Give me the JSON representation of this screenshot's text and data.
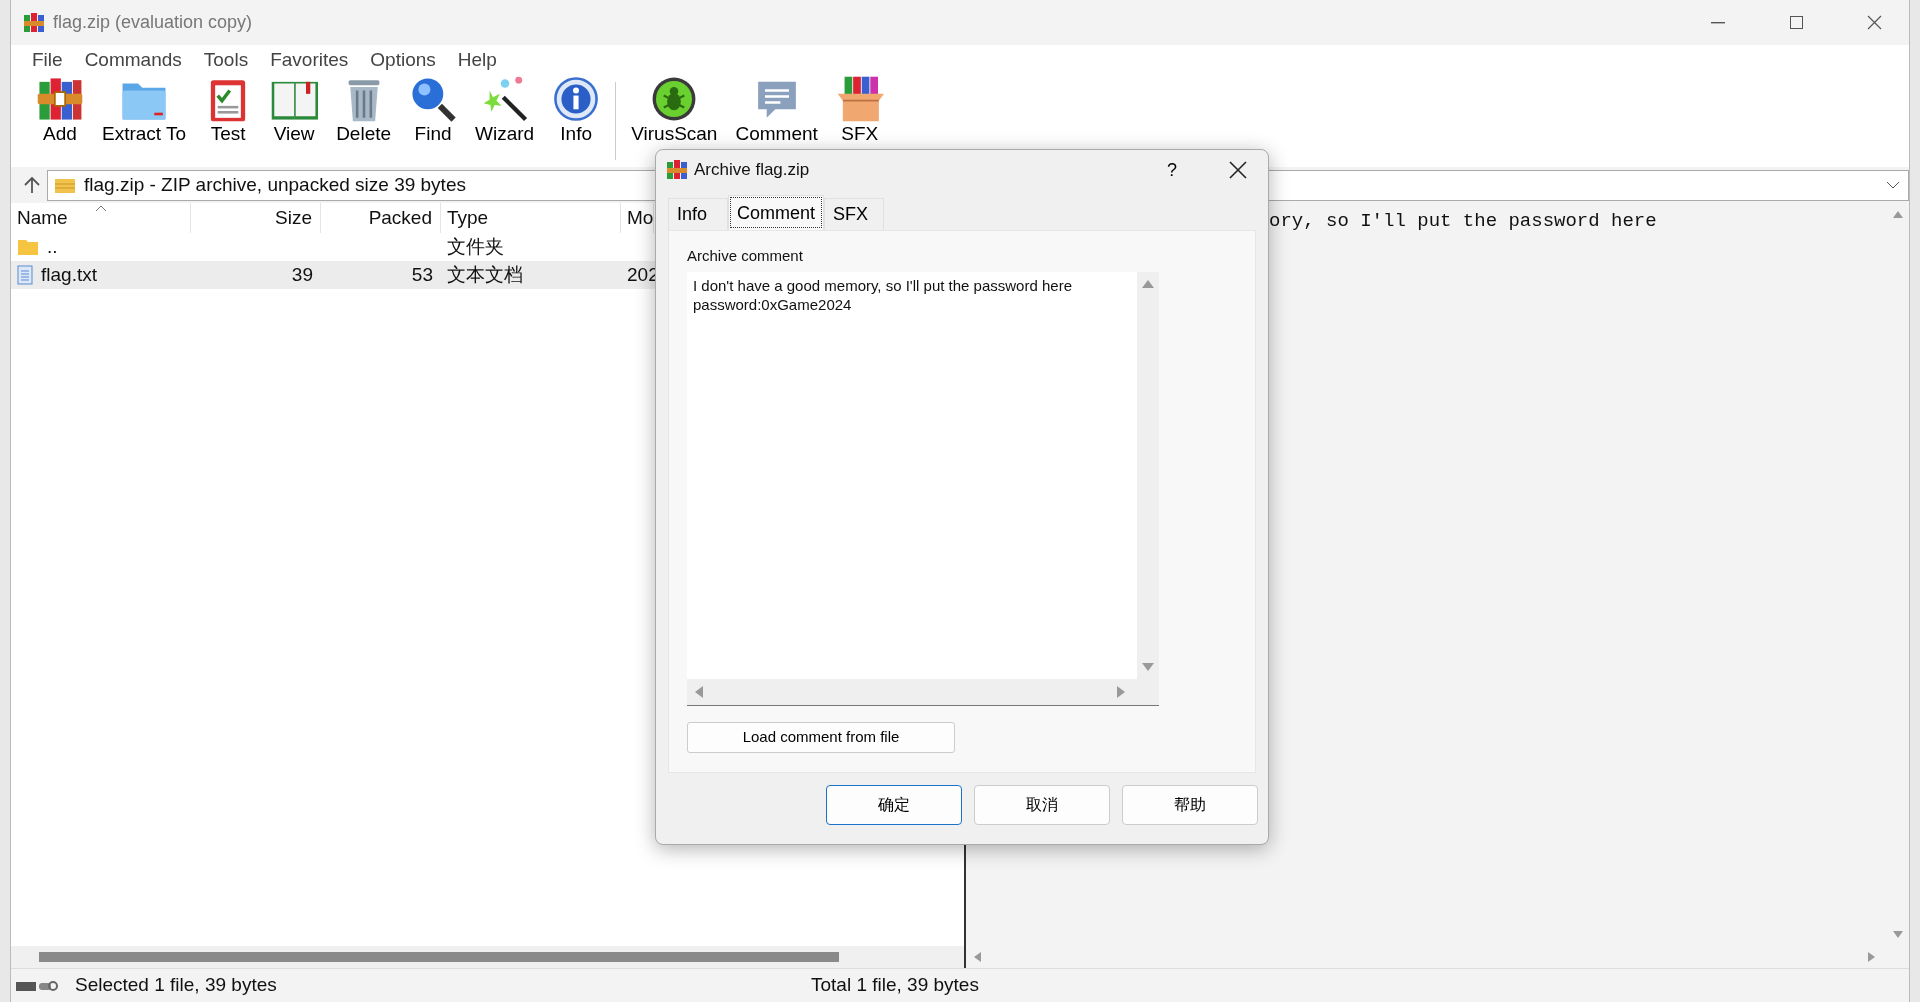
{
  "window": {
    "title": "flag.zip (evaluation copy)"
  },
  "menu": [
    "File",
    "Commands",
    "Tools",
    "Favorites",
    "Options",
    "Help"
  ],
  "toolbar": [
    {
      "label": "Add"
    },
    {
      "label": "Extract To"
    },
    {
      "label": "Test"
    },
    {
      "label": "View"
    },
    {
      "label": "Delete"
    },
    {
      "label": "Find"
    },
    {
      "label": "Wizard"
    },
    {
      "label": "Info"
    },
    {
      "label": "VirusScan"
    },
    {
      "label": "Comment"
    },
    {
      "label": "SFX"
    }
  ],
  "address": "flag.zip - ZIP archive, unpacked size 39 bytes",
  "table": {
    "columns": [
      "Name",
      "Size",
      "Packed",
      "Type",
      "Mo"
    ],
    "rows": [
      {
        "kind": "folder",
        "name": "..",
        "type": "文件夹",
        "selected": false
      },
      {
        "kind": "file",
        "name": "flag.txt",
        "size": "39",
        "packed": "53",
        "type": "文本文档",
        "modified": "202",
        "selected": true
      }
    ]
  },
  "preview": "ory, so I'll put the password here",
  "status_bar": {
    "left": "Selected 1 file, 39 bytes",
    "right": "Total 1 file, 39 bytes"
  },
  "dialog": {
    "title": "Archive flag.zip",
    "help": "?",
    "tabs": [
      {
        "label": "Info",
        "selected": false
      },
      {
        "label": "Comment",
        "selected": true
      },
      {
        "label": "SFX",
        "selected": false
      }
    ],
    "comment_label": "Archive comment",
    "comment": "I don't have a good memory, so I'll put the password here\npassword:0xGame2024",
    "load_button": "Load comment from file",
    "buttons": [
      {
        "label": "确定",
        "default": true
      },
      {
        "label": "取消",
        "default": false
      },
      {
        "label": "帮助",
        "default": false
      }
    ]
  }
}
